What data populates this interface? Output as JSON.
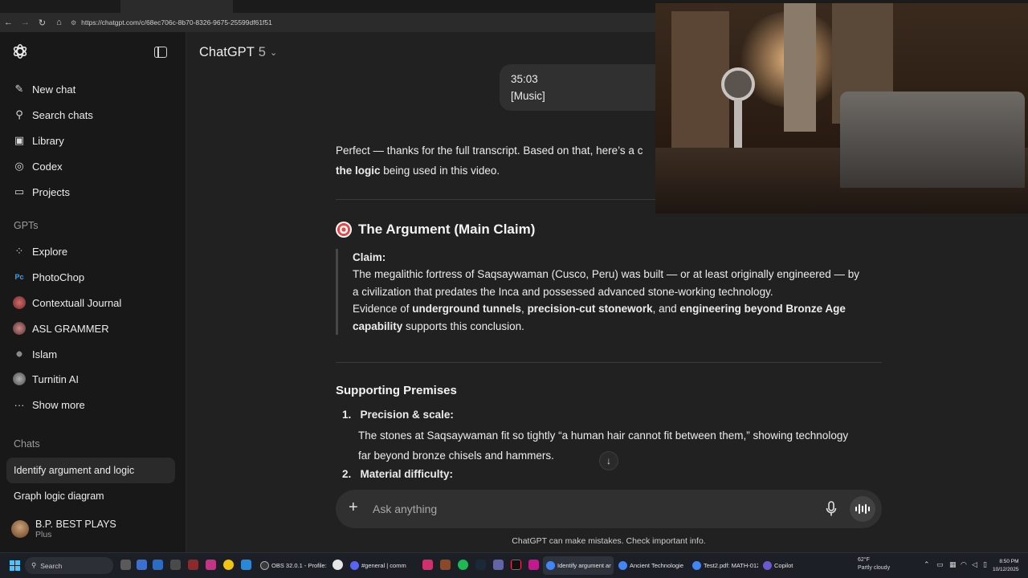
{
  "browser": {
    "url": "https://chatgpt.com/c/68ec706c-8b70-8326-9675-25599df61f51"
  },
  "sidebar": {
    "items": [
      {
        "label": "New chat",
        "icon": "edit-icon"
      },
      {
        "label": "Search chats",
        "icon": "search-icon"
      },
      {
        "label": "Library",
        "icon": "library-icon"
      },
      {
        "label": "Codex",
        "icon": "codex-icon"
      },
      {
        "label": "Projects",
        "icon": "folder-icon"
      }
    ],
    "gpts_label": "GPTs",
    "gpts": [
      {
        "label": "Explore",
        "icon": "grid-icon"
      },
      {
        "label": "PhotoChop",
        "icon": "photoshop-icon"
      },
      {
        "label": "Contextuall Journal",
        "icon": "avatar"
      },
      {
        "label": "ASL GRAMMER",
        "icon": "avatar"
      },
      {
        "label": "Islam",
        "icon": "avatar"
      },
      {
        "label": "Turnitin AI",
        "icon": "avatar"
      },
      {
        "label": "Show more",
        "icon": "more-icon"
      }
    ],
    "chats_label": "Chats",
    "chats": [
      {
        "label": "Identify argument and logic",
        "active": true
      },
      {
        "label": "Graph logic diagram",
        "active": false
      }
    ],
    "user": {
      "name": "B.P. BEST PLAYS",
      "plan": "Plus"
    }
  },
  "header": {
    "model": "ChatGPT",
    "version": "5"
  },
  "user_message": {
    "line1": "35:03",
    "line2": "[Music]"
  },
  "response": {
    "intro_a": "Perfect — thanks for the full transcript. Based on that, here’s a c",
    "intro_b_bold": "the logic",
    "intro_b_rest": " being used in this video.",
    "section_title": "The Argument (Main Claim)",
    "claim_label": "Claim:",
    "claim_line1": "The megalithic fortress of Saqsaywaman (Cusco, Peru) was built — or at least originally engineered — by",
    "claim_line2": "a civilization that predates the Inca and possessed advanced stone-working technology.",
    "evidence_pre": "Evidence of ",
    "evidence_b1": "underground tunnels",
    "evidence_sep1": ", ",
    "evidence_b2": "precision-cut stonework",
    "evidence_sep2": ", and ",
    "evidence_b3": "engineering beyond Bronze Age",
    "evidence_b4": "capability",
    "evidence_post": " supports this conclusion.",
    "premises_title": "Supporting Premises",
    "premises": [
      {
        "num": "1.",
        "title": "Precision & scale:",
        "text1": "The stones at Saqsaywaman fit so tightly “a human hair cannot fit between them,” showing technology",
        "text2": "far beyond bronze chisels and hammers."
      },
      {
        "num": "2.",
        "title": "Material difficulty:"
      }
    ]
  },
  "composer": {
    "placeholder": "Ask anything"
  },
  "disclaimer": "ChatGPT can make mistakes. Check important info.",
  "taskbar": {
    "search": "Search",
    "apps": [
      {
        "label": "OBS 32.0.1 - Profile:",
        "color": "#3a3a3a"
      },
      {
        "label": "#general | comm",
        "color": "#5865f2"
      },
      {
        "label": "Identify argument ar",
        "color": "#4285f4",
        "active": true
      },
      {
        "label": "Ancient Technologie",
        "color": "#4285f4"
      },
      {
        "label": "Test2.pdf: MATH-012",
        "color": "#4285f4"
      },
      {
        "label": "Copilot",
        "color": "#6a5acd"
      }
    ],
    "weather_temp": "62°F",
    "weather_desc": "Partly cloudy",
    "time": "8:50 PM",
    "date": "10/12/2025"
  }
}
